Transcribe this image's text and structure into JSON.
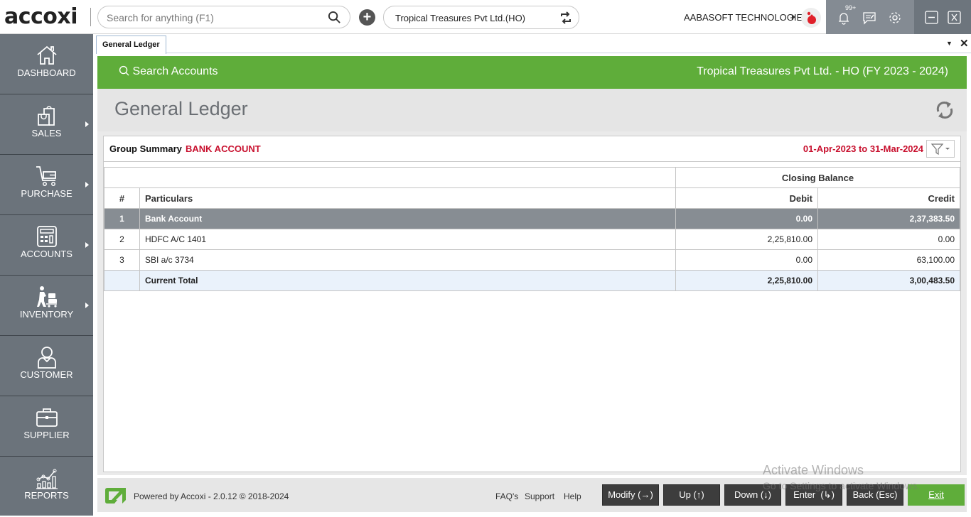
{
  "topbar": {
    "logo": "accoxi",
    "search_placeholder": "Search for anything (F1)",
    "company_selector": "Tropical Treasures Pvt Ltd.(HO)",
    "organization": "AABASOFT TECHNOLOGIES",
    "notification_badge": "99+",
    "icons": [
      "search-icon",
      "add-icon",
      "sync-icon",
      "avatar",
      "bell-icon",
      "message-icon",
      "gear-icon",
      "minimize-icon",
      "close-icon"
    ]
  },
  "sidebar": {
    "items": [
      {
        "label": "DASHBOARD",
        "icon": "home-icon",
        "has_submenu": false
      },
      {
        "label": "SALES",
        "icon": "shopping-bag-icon",
        "has_submenu": true
      },
      {
        "label": "PURCHASE",
        "icon": "cart-icon",
        "has_submenu": true
      },
      {
        "label": "ACCOUNTS",
        "icon": "calculator-icon",
        "has_submenu": true
      },
      {
        "label": "INVENTORY",
        "icon": "worker-trolley-icon",
        "has_submenu": true
      },
      {
        "label": "CUSTOMER",
        "icon": "user-icon",
        "has_submenu": false
      },
      {
        "label": "SUPPLIER",
        "icon": "briefcase-icon",
        "has_submenu": false
      },
      {
        "label": "REPORTS",
        "icon": "chart-icon",
        "has_submenu": false
      }
    ]
  },
  "tabs": [
    {
      "label": "General Ledger",
      "active": true
    }
  ],
  "header": {
    "search_accounts": "Search Accounts",
    "company_fy": "Tropical Treasures Pvt Ltd. - HO (FY 2023 - 2024)",
    "page_title": "General Ledger"
  },
  "group": {
    "label": "Group Summary",
    "name": "BANK ACCOUNT",
    "date_range": "01-Apr-2023 to 31-Mar-2024"
  },
  "table": {
    "group_header": "Closing Balance",
    "columns": [
      "#",
      "Particulars",
      "Debit",
      "Credit"
    ],
    "rows": [
      {
        "num": "1",
        "particulars": "Bank Account",
        "debit": "0.00",
        "credit": "2,37,383.50",
        "selected": true
      },
      {
        "num": "2",
        "particulars": "HDFC A/C 1401",
        "debit": "2,25,810.00",
        "credit": "0.00"
      },
      {
        "num": "3",
        "particulars": "SBI a/c 3734",
        "debit": "0.00",
        "credit": "63,100.00"
      }
    ],
    "total": {
      "label": "Current Total",
      "debit": "2,25,810.00",
      "credit": "3,00,483.50"
    }
  },
  "footer": {
    "powered_by": "Powered by Accoxi - 2.0.12 © 2018-2024",
    "links": [
      "FAQ's",
      "Support",
      "Help"
    ],
    "buttons": [
      "Modify (→)",
      "Up (↑)",
      "Down (↓)",
      "Enter  (↳)",
      "Back (Esc)",
      "Exit"
    ]
  },
  "watermark": {
    "line1": "Activate Windows",
    "line2": "Go to Settings to activate Windows."
  },
  "colors": {
    "brand_green": "#5fad3a",
    "sidebar": "#6b737b",
    "accent_red": "#c8102e",
    "selected_row": "#878d93"
  }
}
